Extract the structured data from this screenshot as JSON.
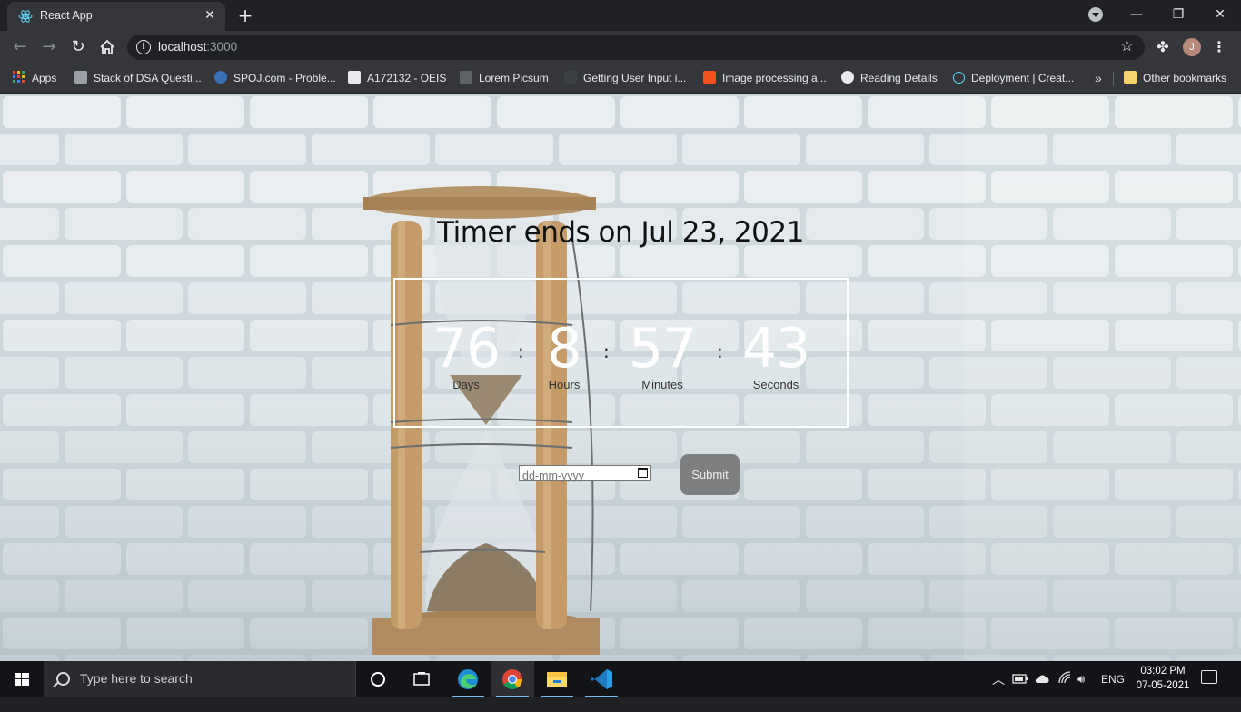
{
  "browser": {
    "tab_title": "React App",
    "url_host": "localhost",
    "url_port": ":3000",
    "bookmarks": [
      {
        "label": "Apps",
        "color": "#ea4335"
      },
      {
        "label": "Stack of DSA Questi...",
        "color": "#9aa0a6"
      },
      {
        "label": "SPOJ.com - Proble...",
        "color": "#3b6fb6"
      },
      {
        "label": "A172132 - OEIS",
        "color": "#e8eaed"
      },
      {
        "label": "Lorem Picsum",
        "color": "#5f6368"
      },
      {
        "label": "Getting User Input i...",
        "color": "#3c4043"
      },
      {
        "label": "Image processing a...",
        "color": "#f4511e"
      },
      {
        "label": "Reading Details",
        "color": "#e8eaed"
      },
      {
        "label": "Deployment | Creat...",
        "color": "#61dafb"
      }
    ],
    "more_bookmarks": "»",
    "other_bookmarks": "Other bookmarks",
    "profile_initial": "J"
  },
  "page": {
    "heading": "Timer ends on Jul 23, 2021",
    "timer": {
      "days": "76",
      "days_label": "Days",
      "hours": "8",
      "hours_label": "Hours",
      "minutes": "57",
      "minutes_label": "Minutes",
      "seconds": "43",
      "seconds_label": "Seconds",
      "separator": ":"
    },
    "date_input_placeholder": "dd-mm-yyyy",
    "submit_label": "Submit"
  },
  "taskbar": {
    "search_placeholder": "Type here to search",
    "language": "ENG",
    "time": "03:02 PM",
    "date": "07-05-2021"
  }
}
